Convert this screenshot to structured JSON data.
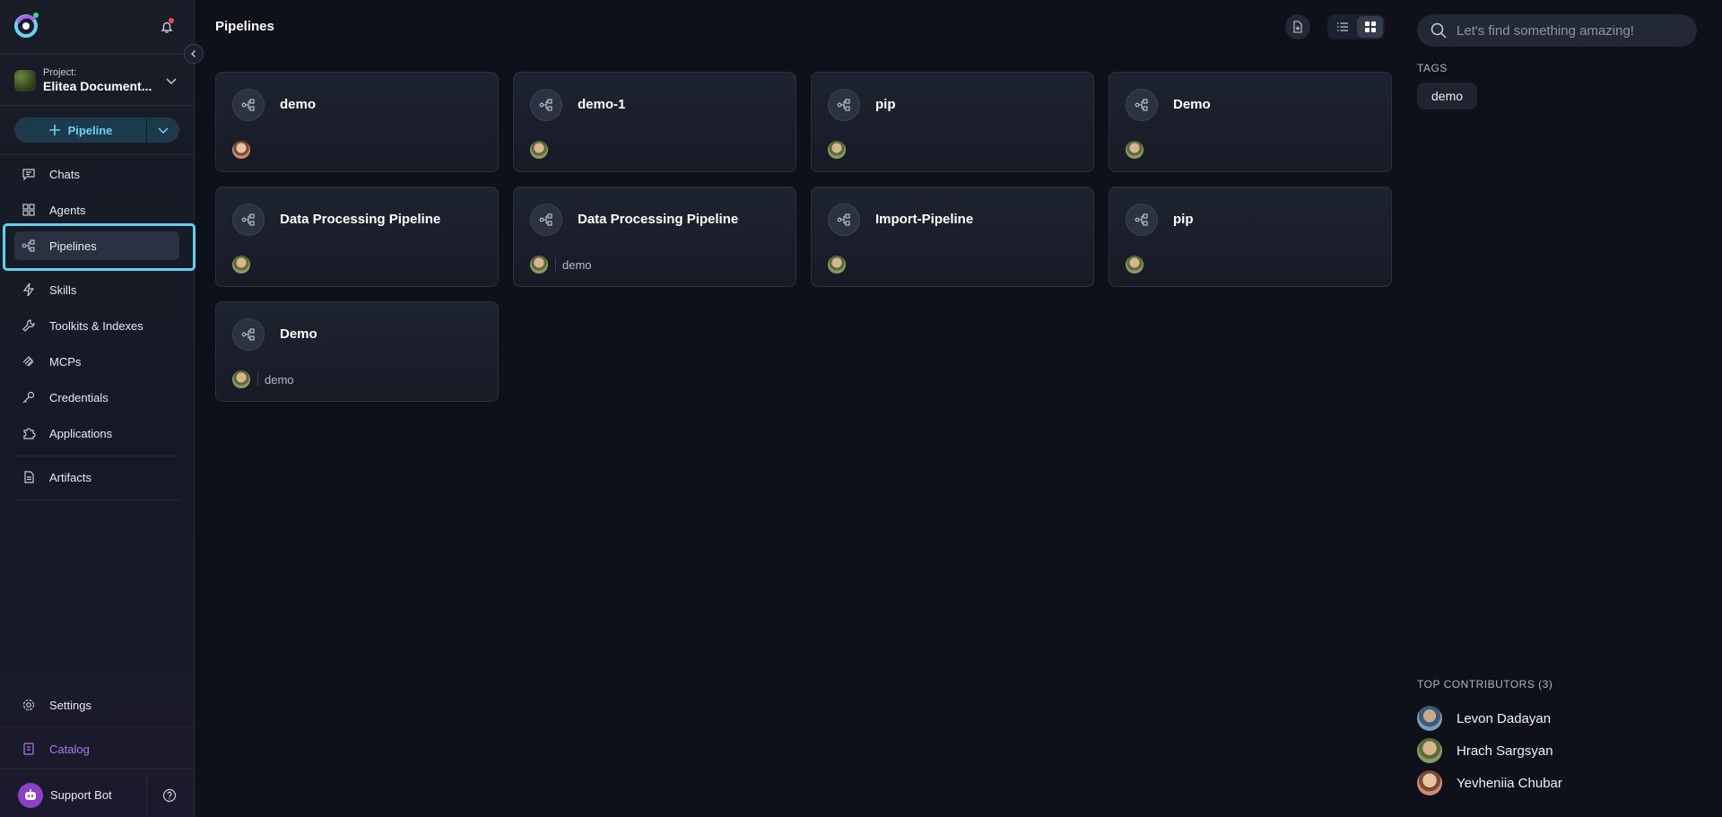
{
  "sidebar": {
    "project_label": "Project:",
    "project_name": "Elitea Document...",
    "create_label": "Pipeline",
    "nav": [
      {
        "label": "Chats",
        "icon": "chat-icon"
      },
      {
        "label": "Agents",
        "icon": "grid-icon"
      },
      {
        "label": "Pipelines",
        "icon": "pipeline-icon"
      },
      {
        "label": "Skills",
        "icon": "lightning-icon"
      },
      {
        "label": "Toolkits & Indexes",
        "icon": "wrench-icon"
      },
      {
        "label": "MCPs",
        "icon": "mcp-icon"
      },
      {
        "label": "Credentials",
        "icon": "key-icon"
      },
      {
        "label": "Applications",
        "icon": "puzzle-icon"
      },
      {
        "label": "Artifacts",
        "icon": "file-icon"
      }
    ],
    "settings_label": "Settings",
    "catalog_label": "Catalog",
    "support_label": "Support Bot"
  },
  "main": {
    "title": "Pipelines",
    "cards": [
      {
        "title": "demo",
        "tag": ""
      },
      {
        "title": "demo-1",
        "tag": ""
      },
      {
        "title": "pip",
        "tag": ""
      },
      {
        "title": "Demo",
        "tag": ""
      },
      {
        "title": "Data Processing Pipeline",
        "tag": ""
      },
      {
        "title": "Data Processing Pipeline",
        "tag": "demo"
      },
      {
        "title": "Import-Pipeline",
        "tag": ""
      },
      {
        "title": "pip",
        "tag": ""
      },
      {
        "title": "Demo",
        "tag": "demo"
      }
    ]
  },
  "right_panel": {
    "search_placeholder": "Let's find something amazing!",
    "tags_title": "TAGS",
    "tags": [
      "demo"
    ],
    "contributors_title": "TOP CONTRIBUTORS (3)",
    "contributors": [
      {
        "name": "Levon Dadayan"
      },
      {
        "name": "Hrach Sargsyan"
      },
      {
        "name": "Yevheniia Chubar"
      }
    ]
  },
  "colors": {
    "accent": "#5ad4f2",
    "catalog": "#a77cf0",
    "background": "#0e111a"
  }
}
